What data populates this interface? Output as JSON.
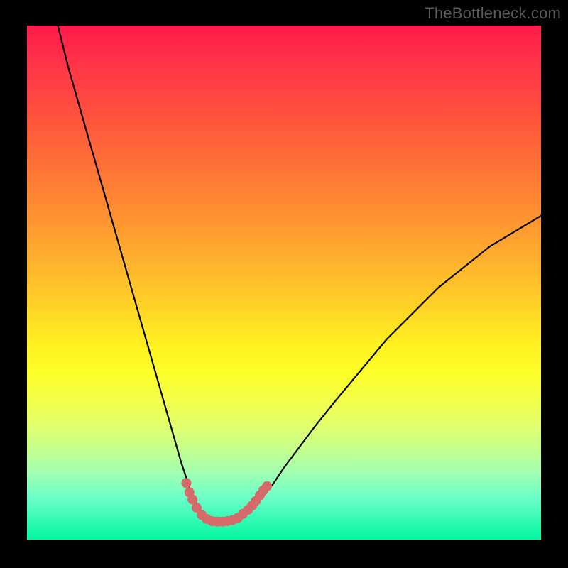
{
  "watermark": "TheBottleneck.com",
  "chart_data": {
    "type": "line",
    "title": "",
    "xlabel": "",
    "ylabel": "",
    "xlim": [
      0,
      100
    ],
    "ylim": [
      0,
      100
    ],
    "grid": false,
    "series": [
      {
        "name": "curve",
        "color": "#000000",
        "x": [
          6,
          8,
          10,
          12,
          14,
          16,
          18,
          20,
          22,
          24,
          26,
          28,
          30,
          32,
          33,
          34,
          35,
          36,
          37,
          38,
          40,
          42,
          44,
          46,
          48,
          50,
          53,
          56,
          60,
          65,
          70,
          75,
          80,
          85,
          90,
          95,
          100
        ],
        "y": [
          100,
          92,
          85,
          78,
          71,
          64,
          57,
          50,
          43,
          36,
          29,
          22,
          15,
          9,
          7,
          5,
          4,
          3.5,
          3.5,
          3.6,
          4,
          5,
          6.5,
          8.5,
          11,
          14,
          18,
          22,
          27,
          33,
          39,
          44,
          49,
          53,
          57,
          60,
          63
        ]
      }
    ],
    "markers": {
      "name": "highlight-dots",
      "color": "#d66a6a",
      "points": [
        {
          "x": 31,
          "y": 11
        },
        {
          "x": 31.6,
          "y": 9.2
        },
        {
          "x": 32.2,
          "y": 7.8
        },
        {
          "x": 33,
          "y": 6.2
        },
        {
          "x": 34,
          "y": 4.8
        },
        {
          "x": 35,
          "y": 4
        },
        {
          "x": 36,
          "y": 3.6
        },
        {
          "x": 37,
          "y": 3.5
        },
        {
          "x": 38,
          "y": 3.5
        },
        {
          "x": 39,
          "y": 3.6
        },
        {
          "x": 40,
          "y": 3.8
        },
        {
          "x": 41,
          "y": 4.2
        },
        {
          "x": 42,
          "y": 5
        },
        {
          "x": 43,
          "y": 5.8
        },
        {
          "x": 43.8,
          "y": 6.6
        },
        {
          "x": 44.5,
          "y": 7.5
        },
        {
          "x": 45.3,
          "y": 8.6
        },
        {
          "x": 46,
          "y": 9.6
        },
        {
          "x": 46.7,
          "y": 10.4
        }
      ]
    }
  }
}
